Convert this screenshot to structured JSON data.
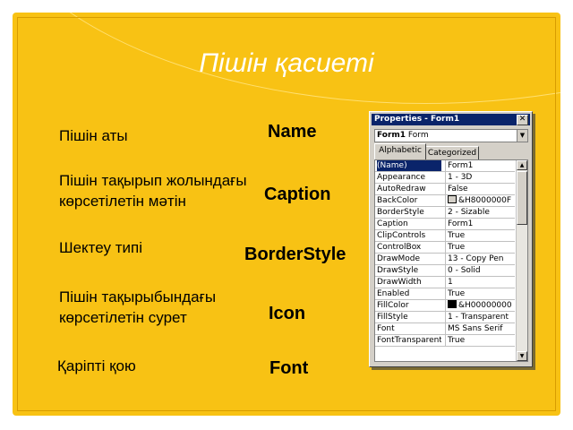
{
  "slide": {
    "title": "Пішін қасиеті",
    "labels": [
      {
        "id": "name",
        "text": "Пішін аты"
      },
      {
        "id": "caption",
        "text": "Пішін тақырып жолындағы көрсетілетін мәтін"
      },
      {
        "id": "border",
        "text": "Шектеу типі"
      },
      {
        "id": "icon",
        "text": "Пішін тақырыбындағы көрсетілетін сурет"
      },
      {
        "id": "font",
        "text": "Қаріпті қою"
      }
    ],
    "keywords": [
      "Name",
      "Caption",
      "BorderStyle",
      "Icon",
      "Font"
    ]
  },
  "properties_window": {
    "title": "Properties - Form1",
    "close_glyph": "✕",
    "object_name": "Form1",
    "object_type": "Form",
    "tabs": [
      "Alphabetic",
      "Categorized"
    ],
    "active_tab": "Alphabetic",
    "rows": [
      {
        "name": "(Name)",
        "value": "Form1"
      },
      {
        "name": "Appearance",
        "value": "1 - 3D"
      },
      {
        "name": "AutoRedraw",
        "value": "False"
      },
      {
        "name": "BackColor",
        "value": "&H8000000F",
        "swatch": "#d4d0c8"
      },
      {
        "name": "BorderStyle",
        "value": "2 - Sizable"
      },
      {
        "name": "Caption",
        "value": "Form1"
      },
      {
        "name": "ClipControls",
        "value": "True"
      },
      {
        "name": "ControlBox",
        "value": "True"
      },
      {
        "name": "DrawMode",
        "value": "13 - Copy Pen"
      },
      {
        "name": "DrawStyle",
        "value": "0 - Solid"
      },
      {
        "name": "DrawWidth",
        "value": "1"
      },
      {
        "name": "Enabled",
        "value": "True"
      },
      {
        "name": "FillColor",
        "value": "&H00000000",
        "swatch": "#000000"
      },
      {
        "name": "FillStyle",
        "value": "1 - Transparent"
      },
      {
        "name": "Font",
        "value": "MS Sans Serif"
      },
      {
        "name": "FontTransparent",
        "value": "True"
      }
    ]
  },
  "colors": {
    "slide_bg": "#f8c214",
    "title_bar": "#0a246a"
  }
}
